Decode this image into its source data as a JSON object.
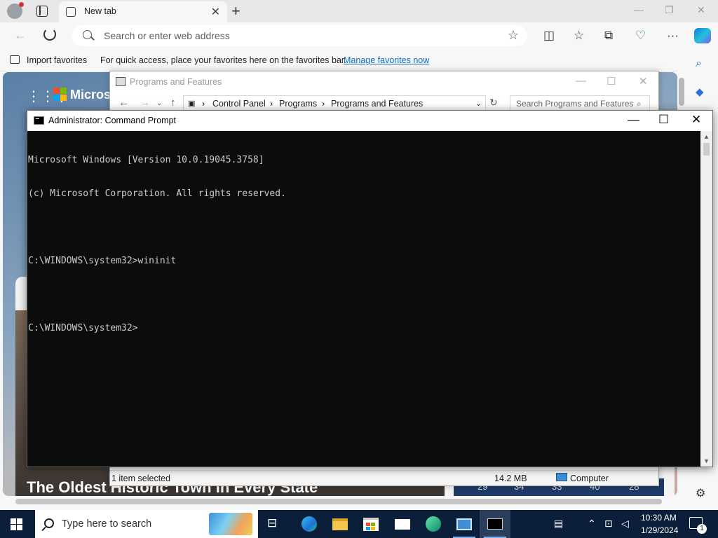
{
  "browser": {
    "tab_title": "New tab",
    "address_placeholder": "Search or enter web address",
    "favorites": {
      "import_label": "Import favorites",
      "hint": "For quick access, place your favorites here on the favorites bar.",
      "manage_link": "Manage favorites now"
    },
    "ntp": {
      "brand": "Microso",
      "headline": "The Oldest Historic Town In Every State",
      "weather_temps": [
        "29°",
        "34°",
        "33°",
        "40°",
        "28°"
      ]
    }
  },
  "programs_window": {
    "title": "Programs and Features",
    "breadcrumb": [
      "Control Panel",
      "Programs",
      "Programs and Features"
    ],
    "search_placeholder": "Search Programs and Features",
    "status": {
      "selected": "1 item selected",
      "size": "14.2 MB",
      "location": "Computer"
    }
  },
  "cmd_window": {
    "title": "Administrator: Command Prompt",
    "lines": [
      "Microsoft Windows [Version 10.0.19045.3758]",
      "(c) Microsoft Corporation. All rights reserved.",
      "",
      "C:\\WINDOWS\\system32>wininit",
      "",
      "C:\\WINDOWS\\system32>"
    ]
  },
  "taskbar": {
    "search_placeholder": "Type here to search",
    "apps": [
      "task-view",
      "edge",
      "file-explorer",
      "microsoft-store",
      "mail",
      "edge-dev",
      "control-panel",
      "command-prompt"
    ],
    "clock_time": "10:30 AM",
    "clock_date": "1/29/2024",
    "notification_count": "1"
  },
  "colors": {
    "taskbar_bg": "#0c1f3a",
    "cmd_bg": "#0c0c0c",
    "cmd_text": "#cccccc",
    "link": "#0f6cbd"
  }
}
